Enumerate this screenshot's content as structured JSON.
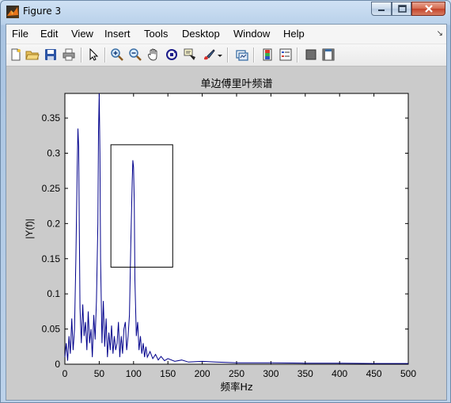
{
  "window": {
    "title": "Figure 3"
  },
  "menu": [
    "File",
    "Edit",
    "View",
    "Insert",
    "Tools",
    "Desktop",
    "Window",
    "Help"
  ],
  "toolbar_icons": [
    "new-figure-icon",
    "open-file-icon",
    "save-icon",
    "print-icon",
    "edit-plot-arrow-icon",
    "zoom-in-icon",
    "zoom-out-icon",
    "pan-hand-icon",
    "rotate-3d-icon",
    "data-cursor-icon",
    "brush-icon",
    "brush-dropdown-icon",
    "link-plot-icon",
    "insert-colorbar-icon",
    "insert-legend-icon",
    "hide-plot-tools-icon",
    "show-plot-tools-icon"
  ],
  "chart_data": {
    "type": "line",
    "title": "单边傅里叶频谱",
    "xlabel": "频率Hz",
    "ylabel": "|Y(f)|",
    "xlim": [
      0,
      500
    ],
    "ylim": [
      0,
      0.385
    ],
    "xticks": [
      0,
      50,
      100,
      150,
      200,
      250,
      300,
      350,
      400,
      450,
      500
    ],
    "yticks": [
      0,
      0.05,
      0.1,
      0.15,
      0.2,
      0.25,
      0.3,
      0.35
    ],
    "ytick_labels": [
      "0",
      "0.05",
      "0.1",
      "0.15",
      "0.2",
      "0.25",
      "0.3",
      "0.35"
    ],
    "line_color": "#00008b",
    "grid": false,
    "series": [
      {
        "x": [
          0,
          2,
          4,
          6,
          8,
          10,
          12,
          14,
          16,
          18,
          19,
          20,
          21,
          22,
          24,
          26,
          28,
          30,
          32,
          34,
          36,
          38,
          40,
          42,
          44,
          46,
          48,
          49,
          50,
          51,
          52,
          54,
          56,
          58,
          60,
          62,
          64,
          66,
          68,
          70,
          72,
          74,
          76,
          78,
          80,
          82,
          84,
          86,
          88,
          90,
          92,
          94,
          96,
          98,
          99,
          100,
          101,
          102,
          104,
          106,
          108,
          110,
          112,
          114,
          116,
          118,
          120,
          124,
          128,
          132,
          136,
          140,
          145,
          150,
          160,
          170,
          180,
          200,
          220,
          250,
          300,
          350,
          400,
          450,
          500
        ],
        "y": [
          0.01,
          0.03,
          0.005,
          0.04,
          0.015,
          0.065,
          0.02,
          0.05,
          0.15,
          0.28,
          0.335,
          0.31,
          0.2,
          0.08,
          0.03,
          0.085,
          0.04,
          0.06,
          0.02,
          0.075,
          0.03,
          0.05,
          0.01,
          0.07,
          0.035,
          0.09,
          0.2,
          0.33,
          0.39,
          0.3,
          0.15,
          0.03,
          0.09,
          0.025,
          0.065,
          0.01,
          0.045,
          0.02,
          0.055,
          0.015,
          0.04,
          0.02,
          0.03,
          0.06,
          0.01,
          0.04,
          0.015,
          0.05,
          0.06,
          0.02,
          0.04,
          0.07,
          0.17,
          0.26,
          0.29,
          0.28,
          0.23,
          0.12,
          0.04,
          0.06,
          0.02,
          0.04,
          0.015,
          0.03,
          0.01,
          0.025,
          0.01,
          0.018,
          0.008,
          0.014,
          0.006,
          0.011,
          0.005,
          0.008,
          0.004,
          0.006,
          0.003,
          0.004,
          0.003,
          0.002,
          0.002,
          0.0015,
          0.0015,
          0.001,
          0.001
        ]
      }
    ],
    "annotation_rectangle": {
      "x_range": [
        67,
        157
      ],
      "y_range": [
        0.138,
        0.312
      ]
    }
  }
}
